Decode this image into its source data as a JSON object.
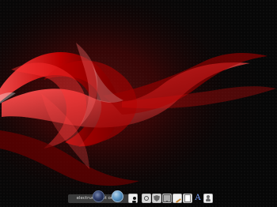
{
  "desktop": {
    "taskbar": {
      "active_window_label": "electrum [Not online]"
    },
    "icons": [
      "launcher-orb-icon",
      "browser-orb-icon",
      "gnome-foot-icon",
      "settings-gear-icon",
      "shield-icon",
      "display-icon",
      "notes-pencil-icon",
      "document-icon",
      "text-a-icon",
      "user-avatar-icon"
    ],
    "colors": {
      "background": "#070707",
      "accent": "#e01010",
      "dock_label_bg": "#3a3a3a",
      "dock_text": "#d8d8d8"
    }
  }
}
